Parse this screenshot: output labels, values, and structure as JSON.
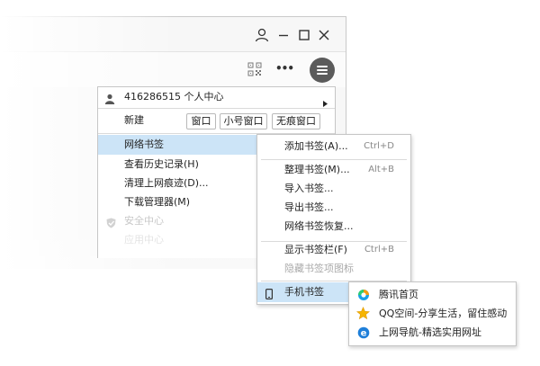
{
  "toolbar": {
    "more_label": "•••"
  },
  "main_menu": {
    "account": "416286515 个人中心",
    "new_label": "新建",
    "new_buttons": [
      "窗口",
      "小号窗口",
      "无痕窗口"
    ],
    "bookmarks": "网络书签",
    "history": "查看历史记录(H)",
    "clear": "清理上网痕迹(D)...",
    "downloads": "下载管理器(M)",
    "security": "安全中心",
    "partial": "应用中心"
  },
  "bookmark_menu": {
    "add": "添加书签(A)...",
    "add_sc": "Ctrl+D",
    "organize": "整理书签(M)...",
    "organize_sc": "Alt+B",
    "import": "导入书签...",
    "export": "导出书签...",
    "restore": "网络书签恢复...",
    "show_bar": "显示书签栏(F)",
    "show_bar_sc": "Ctrl+B",
    "hide_icons": "隐藏书签项图标",
    "mobile": "手机书签"
  },
  "mobile_menu": {
    "items": [
      "腾讯首页",
      "QQ空间-分享生活，留住感动",
      "上网导航-精选实用网址"
    ]
  },
  "colors": {
    "highlight": "#cce4f7",
    "menu_button": "#5b5b5b"
  }
}
